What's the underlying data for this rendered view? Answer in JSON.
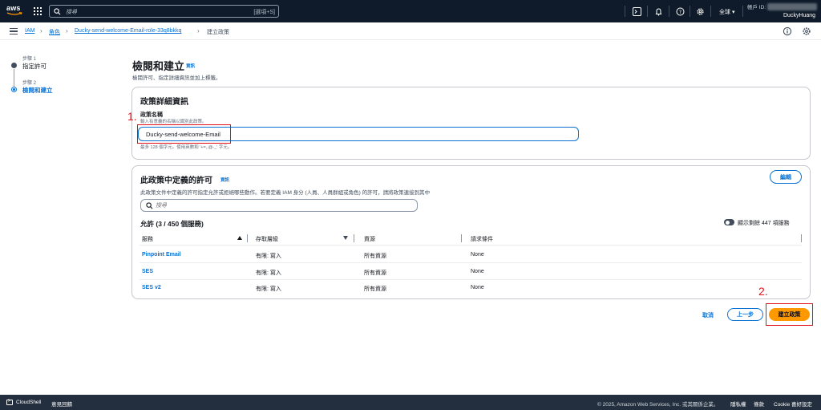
{
  "topnav": {
    "search_placeholder": "搜尋",
    "search_shortcut": "[選項+S]",
    "region": "全球 ▾",
    "account_label": "帳戶 ID:",
    "username": "DuckyHuang"
  },
  "breadcrumb": {
    "items": [
      "IAM",
      "角色",
      "Ducky-send-welcome-Email-role-33q8bkkq",
      "建立政策"
    ]
  },
  "steps": [
    {
      "caption": "步驟 1",
      "label": "指定許可"
    },
    {
      "caption": "步驟 2",
      "label": "檢閱和建立"
    }
  ],
  "page": {
    "title": "檢閱和建立",
    "info": "資訊",
    "description": "檢閱許可、指定詳細資訊並加上標籤。"
  },
  "policy_details": {
    "title": "政策詳細資訊",
    "name_label": "政策名稱",
    "name_desc": "輸入有意義的名稱以識別此政策。",
    "name_value": "Ducky-send-welcome-Email",
    "name_hint": "最多 128 個字元。使用英數和 '+=,.@-_' 字元。"
  },
  "annotations": {
    "first": "1.",
    "second": "2."
  },
  "permissions": {
    "title": "此政策中定義的許可",
    "info": "資訊",
    "description": "此政策文件中定義的許可指定允許或拒絕哪些動作。若要定義 IAM 身分 (人員、人員群組或角色) 的許可，請將政策連接到其中",
    "edit": "編輯",
    "search_placeholder": "搜尋",
    "allow_title": "允許 (3 / 450 個服務)",
    "toggle_label": "顯示剩餘 447 項服務",
    "columns": [
      "服務",
      "存取層級",
      "資源",
      "請求條件"
    ],
    "rows": [
      {
        "service": "Pinpoint Email",
        "access": "有限: 寫入",
        "resource": "所有資源",
        "condition": "None"
      },
      {
        "service": "SES",
        "access": "有限: 寫入",
        "resource": "所有資源",
        "condition": "None"
      },
      {
        "service": "SES v2",
        "access": "有限: 寫入",
        "resource": "所有資源",
        "condition": "None"
      }
    ]
  },
  "actions": {
    "cancel": "取消",
    "previous": "上一步",
    "create": "建立政策"
  },
  "footer": {
    "cloudshell": "CloudShell",
    "feedback": "意見回饋",
    "copyright": "© 2025, Amazon Web Services, Inc. 或其關係企業。",
    "privacy": "隱私權",
    "terms": "條款",
    "cookies": "Cookie 喜好設定"
  },
  "colors": {
    "accent": "#0972d3",
    "primary_button": "#ff9900",
    "highlight": "#e0111a",
    "nav": "#0f1b2a",
    "footer": "#232f3e"
  }
}
